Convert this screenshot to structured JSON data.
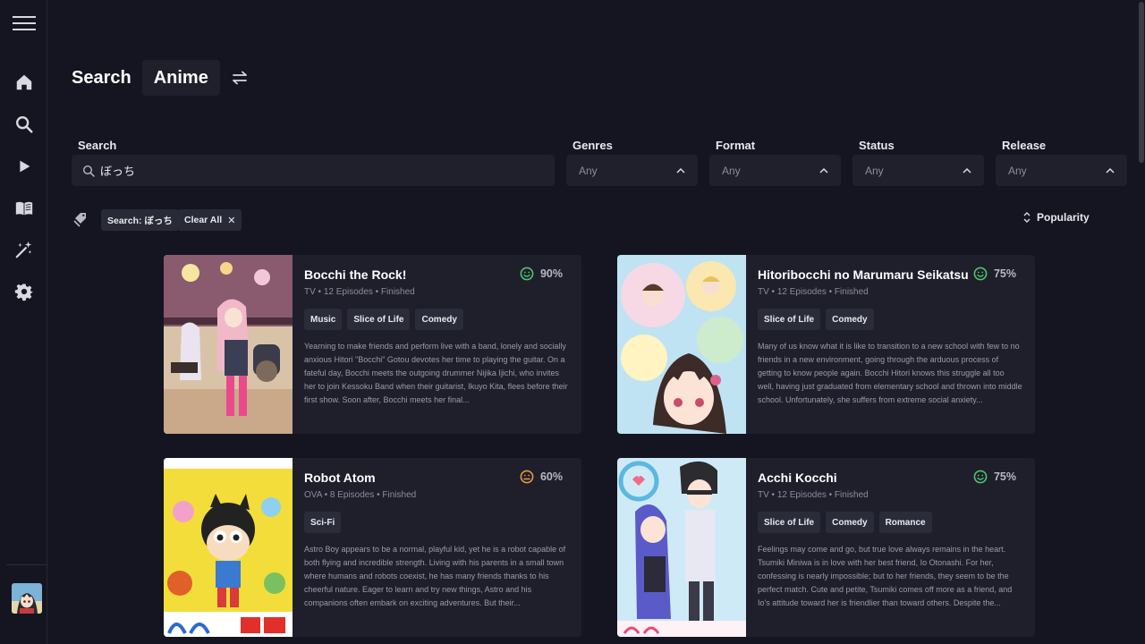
{
  "sidebar": {
    "icons": [
      "menu-icon",
      "home-icon",
      "search-icon",
      "play-icon",
      "book-icon",
      "sparkle-wand-icon",
      "gear-icon"
    ]
  },
  "header": {
    "title": "Search",
    "media_type": "Anime"
  },
  "filters": {
    "search_label": "Search",
    "search_value": "ぼっち",
    "genres_label": "Genres",
    "genres_value": "Any",
    "format_label": "Format",
    "format_value": "Any",
    "status_label": "Status",
    "status_value": "Any",
    "release_label": "Release",
    "release_value": "Any"
  },
  "active_tags": {
    "search_chip": "Search: ぼっち",
    "clear_chip": "Clear All"
  },
  "sort": {
    "label": "Popularity"
  },
  "results": [
    {
      "title": "Bocchi the Rock!",
      "score": "90%",
      "score_mood": "happy",
      "score_color": "#4ec46a",
      "meta": "TV • 12 Episodes • Finished",
      "genres": [
        "Music",
        "Slice of Life",
        "Comedy"
      ],
      "description": "Yearning to make friends and perform live with a band, lonely and socially anxious Hitori \"Bocchi\" Gotou devotes her time to playing the guitar. On a fateful day, Bocchi meets the outgoing drummer Nijika Ijichi, who invites her to join Kessoku Band when their guitarist, Ikuyo Kita, flees before their first show. Soon after, Bocchi meets her final..."
    },
    {
      "title": "Hitoribocchi no Marumaru Seikatsu",
      "score": "75%",
      "score_mood": "happy",
      "score_color": "#4ec46a",
      "meta": "TV • 12 Episodes • Finished",
      "genres": [
        "Slice of Life",
        "Comedy"
      ],
      "description": "Many of us know what it is like to transition to a new school with few to no friends in a new environment, going through the arduous process of getting to know people again. Bocchi Hitori knows this struggle all too well, having just graduated from elementary school and thrown into middle school. Unfortunately, she suffers from extreme social anxiety..."
    },
    {
      "title": "Robot Atom",
      "score": "60%",
      "score_mood": "neutral",
      "score_color": "#e89a3c",
      "meta": "OVA • 8 Episodes • Finished",
      "genres": [
        "Sci-Fi"
      ],
      "description": "Astro Boy appears to be a normal, playful kid, yet he is a robot capable of both flying and incredible strength. Living with his parents in a small town where humans and robots coexist, he has many friends thanks to his cheerful nature. Eager to learn and try new things, Astro and his companions often embark on exciting adventures. But their..."
    },
    {
      "title": "Acchi Kocchi",
      "score": "75%",
      "score_mood": "happy",
      "score_color": "#4ec46a",
      "meta": "TV • 12 Episodes • Finished",
      "genres": [
        "Slice of Life",
        "Comedy",
        "Romance"
      ],
      "description": "Feelings may come and go, but true love always remains in the heart. Tsumiki Miniwa is in love with her best friend, Io Otonashi. For her, confessing is nearly impossible; but to her friends, they seem to be the perfect match. Cute and petite, Tsumiki comes off more as a friend, and Io's attitude toward her is friendlier than toward others. Despite the..."
    }
  ]
}
